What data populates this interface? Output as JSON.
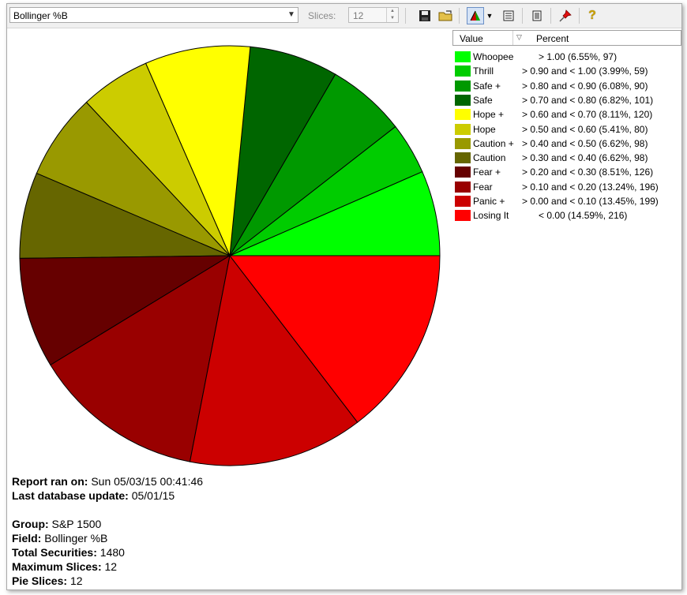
{
  "toolbar": {
    "field_select_value": "Bollinger %B",
    "slices_label": "Slices:",
    "slices_value": "12",
    "icons": [
      "save-icon",
      "open-folder-icon",
      "pie-chart-icon",
      "dropdown-arrow-icon",
      "list-view-icon",
      "report-view-icon",
      "pin-icon",
      "help-icon"
    ]
  },
  "legend": {
    "header_value": "Value",
    "header_percent": "Percent",
    "items": [
      {
        "name": "Whoopee",
        "range": "> 1.00 (6.55%, 97)",
        "color": "#00ff00"
      },
      {
        "name": "Thrill",
        "range": "> 0.90 and < 1.00 (3.99%, 59)",
        "color": "#00cc00"
      },
      {
        "name": "Safe +",
        "range": "> 0.80 and < 0.90 (6.08%, 90)",
        "color": "#009900"
      },
      {
        "name": "Safe",
        "range": "> 0.70 and < 0.80 (6.82%, 101)",
        "color": "#006600"
      },
      {
        "name": "Hope +",
        "range": "> 0.60 and < 0.70 (8.11%, 120)",
        "color": "#ffff00"
      },
      {
        "name": "Hope",
        "range": "> 0.50 and < 0.60 (5.41%, 80)",
        "color": "#cccc00"
      },
      {
        "name": "Caution +",
        "range": "> 0.40 and < 0.50 (6.62%, 98)",
        "color": "#999900"
      },
      {
        "name": "Caution",
        "range": "> 0.30 and < 0.40 (6.62%, 98)",
        "color": "#666600"
      },
      {
        "name": "Fear +",
        "range": "> 0.20 and < 0.30 (8.51%, 126)",
        "color": "#660000"
      },
      {
        "name": "Fear",
        "range": "> 0.10 and < 0.20 (13.24%, 196)",
        "color": "#990000"
      },
      {
        "name": "Panic +",
        "range": "> 0.00 and < 0.10 (13.45%, 199)",
        "color": "#cc0000"
      },
      {
        "name": "Losing It",
        "range": "< 0.00 (14.59%, 216)",
        "color": "#ff0000"
      }
    ]
  },
  "chart_data": {
    "type": "pie",
    "labels": [
      "Whoopee",
      "Thrill",
      "Safe +",
      "Safe",
      "Hope +",
      "Hope",
      "Caution +",
      "Caution",
      "Fear +",
      "Fear",
      "Panic +",
      "Losing It"
    ],
    "values": [
      97,
      59,
      90,
      101,
      120,
      80,
      98,
      98,
      126,
      196,
      199,
      216
    ],
    "colors": [
      "#00ff00",
      "#00cc00",
      "#009900",
      "#006600",
      "#ffff00",
      "#cccc00",
      "#999900",
      "#666600",
      "#660000",
      "#990000",
      "#cc0000",
      "#ff0000"
    ]
  },
  "report": {
    "ran_on_label": "Report ran on:",
    "ran_on_value": "Sun 05/03/15 00:41:46",
    "db_update_label": "Last database update:",
    "db_update_value": "05/01/15",
    "group_label": "Group:",
    "group_value": "S&P 1500",
    "field_label": "Field:",
    "field_value": "Bollinger %B",
    "total_label": "Total Securities:",
    "total_value": "1480",
    "max_slices_label": "Maximum Slices:",
    "max_slices_value": "12",
    "pie_slices_label": "Pie Slices:",
    "pie_slices_value": "12"
  }
}
